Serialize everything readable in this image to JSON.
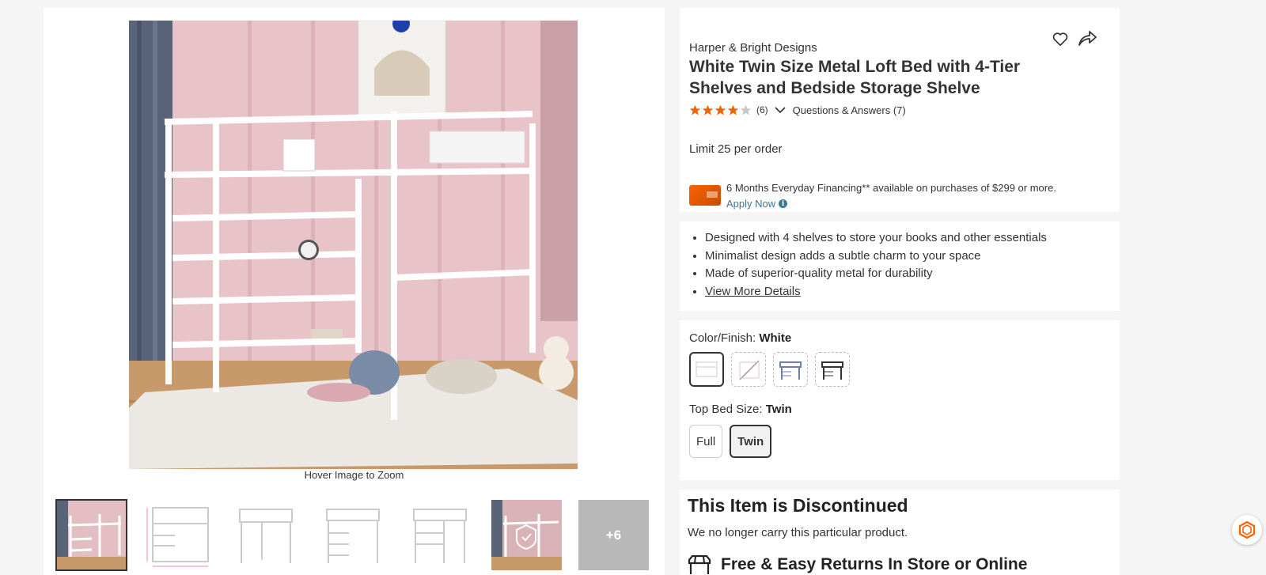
{
  "gallery": {
    "hover_hint": "Hover Image to Zoom",
    "more_count": "+6",
    "thumbnail_count": 7
  },
  "product": {
    "brand": "Harper & Bright Designs",
    "title": "White Twin Size Metal Loft Bed with 4-Tier Shelves and Bedside Storage Shelve",
    "rating": 4,
    "review_count": "(6)",
    "qa_link": "Questions & Answers (7)",
    "limit": "Limit 25 per order",
    "financing_text": "6 Months Everyday Financing** available on purchases of $299 or more.",
    "apply_now": "Apply Now"
  },
  "bullets": [
    "Designed with 4 shelves to store your books and other essentials",
    "Minimalist design adds a subtle charm to your space",
    "Made of superior-quality metal for durability"
  ],
  "view_more_details": "View More Details",
  "options": {
    "color_label": "Color/Finish: ",
    "color_value": "White",
    "size_label": "Top Bed Size: ",
    "size_value": "Twin",
    "sizes": [
      "Full",
      "Twin"
    ]
  },
  "discontinued": {
    "title": "This Item is Discontinued",
    "subtitle": "We no longer carry this particular product.",
    "returns": "Free & Easy Returns In Store or Online"
  },
  "colors": {
    "accent": "#f96302",
    "link": "#3e7697",
    "star": "#f96302"
  }
}
